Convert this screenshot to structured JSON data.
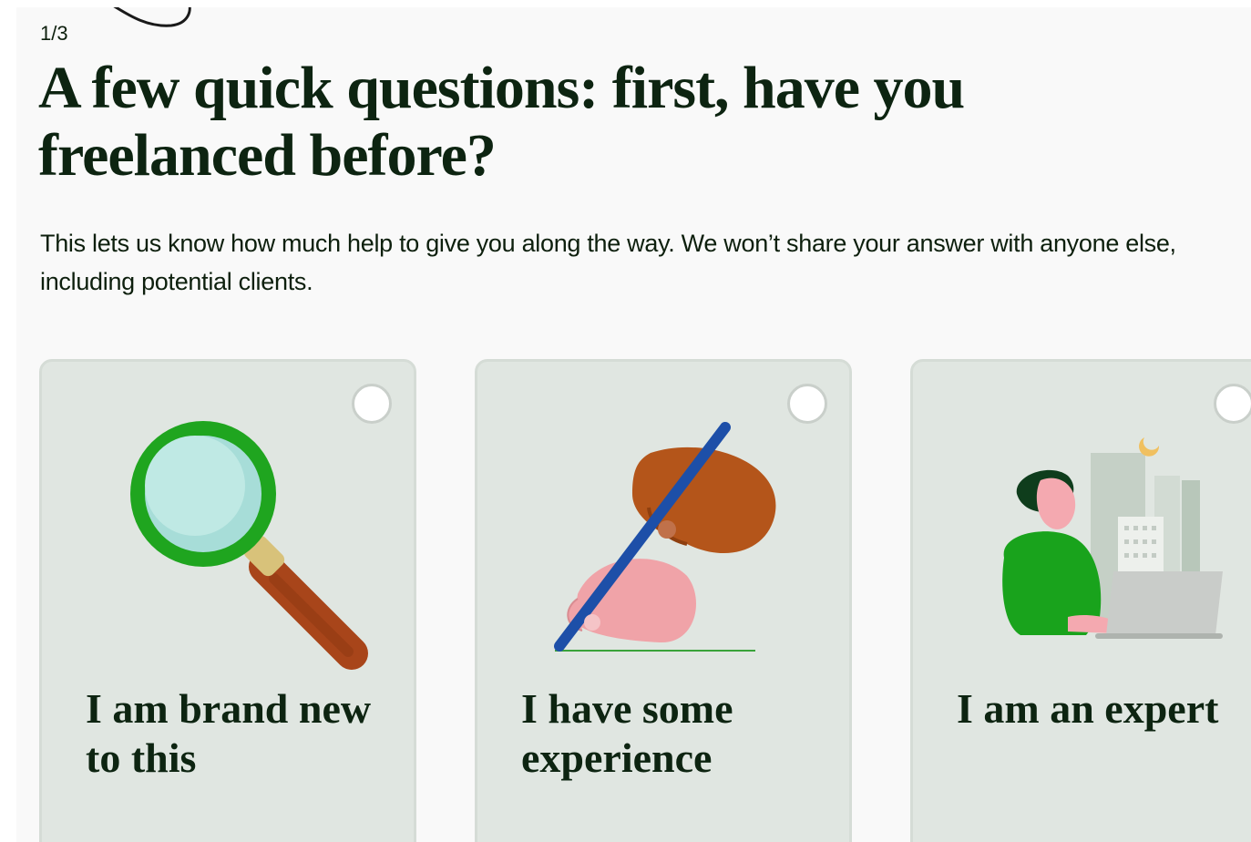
{
  "step_indicator": "1/3",
  "heading": "A few quick questions: first, have you freelanced before?",
  "description": "This lets us know how much help to give you along the way. We won’t share your answer with anyone else, including potential clients.",
  "options": [
    {
      "label": "I am brand new to this",
      "icon": "magnifying-glass-icon",
      "selected": false
    },
    {
      "label": "I have some experience",
      "icon": "hands-writing-icon",
      "selected": false
    },
    {
      "label": "I am an expert",
      "icon": "person-at-laptop-icon",
      "selected": false
    }
  ],
  "colors": {
    "page_bg": "#f9f9f9",
    "card_bg": "#e0e6e1",
    "text_dark": "#0d2411",
    "accent_green": "#14a800"
  }
}
